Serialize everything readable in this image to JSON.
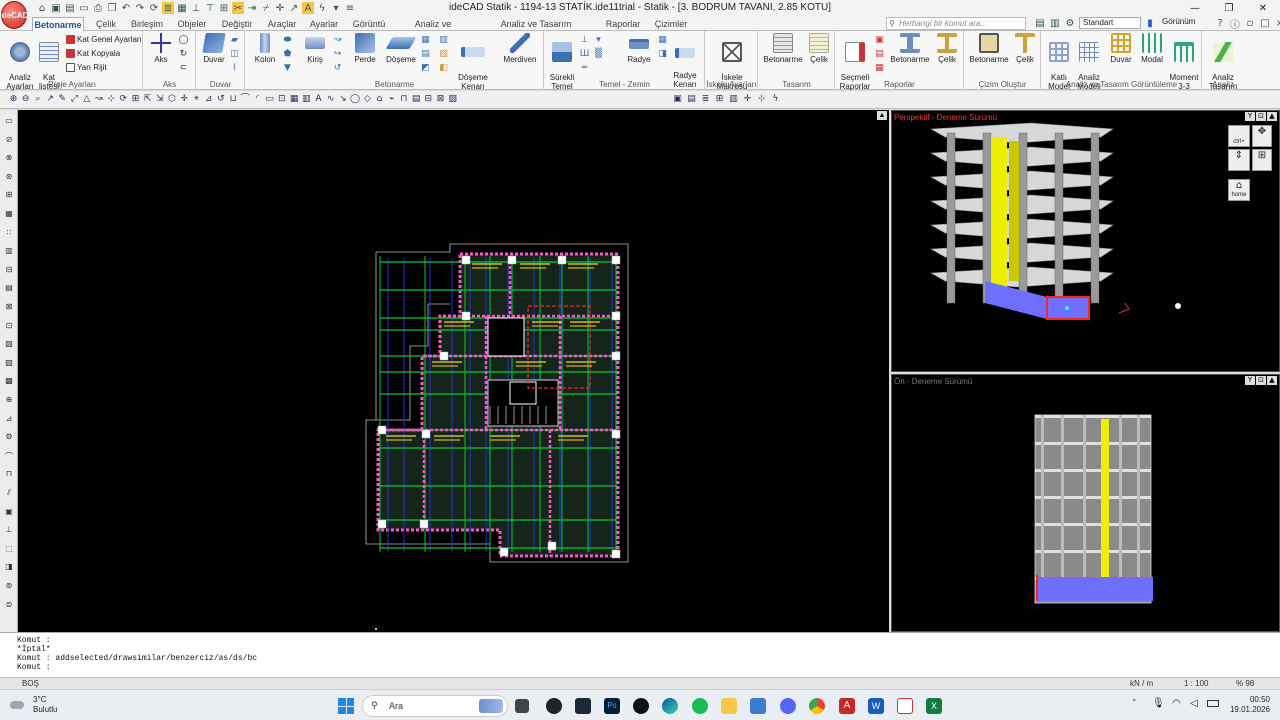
{
  "app": {
    "title": "ideCAD Statik - 1194-13 STATİK.ide11trial - Statik - [3. BODRUM TAVANI,  2.85 KOTU]",
    "logo_text": "ideCAD"
  },
  "tabs": [
    "Betonarme",
    "Çelik",
    "Birleşim",
    "Objeler",
    "Değiştir",
    "Araçlar",
    "Ayarlar",
    "Görüntü",
    "Analiz ve Tasarım",
    "Analiz ve Tasarım Görüntüleme",
    "Raporlar",
    "Çizimler"
  ],
  "search": {
    "placeholder": "Herhangi bir komut ara..."
  },
  "right_controls": {
    "style_value": "Standart",
    "view_label": "Görünüm"
  },
  "ribbon": {
    "proje": {
      "label": "Proje Ayarları",
      "analiz_ayarlari": "Analiz\nAyarları",
      "kat_listesi": "Kat\nlistesi",
      "kat_genel": "Kat Genel Ayarları",
      "kat_kopyala": "Kat Kopyala",
      "yari_rijit": "Yarı Rijit"
    },
    "aks": {
      "label": "Aks",
      "aks": "Aks"
    },
    "duvar": {
      "label": "Duvar",
      "duvar": "Duvar"
    },
    "betonarme": {
      "label": "Betonarme",
      "kolon": "Kolon",
      "kiris": "Kiriş",
      "perde": "Perde",
      "doseme": "Döşeme",
      "doseme_kenari": "Döşeme\nKenarı",
      "merdiven": "Merdiven"
    },
    "temel": {
      "label": "Temel - Zemin",
      "surekli_temel": "Sürekli\nTemel",
      "radye": "Radye",
      "radye_kenari": "Radye\nKenarı"
    },
    "iskele": {
      "label": "İskele Ayarları",
      "iskele_makrosu": "İskele\nMakrosu"
    },
    "tasarim": {
      "label": "Tasarım",
      "betonarme": "Betonarme",
      "celik": "Çelik"
    },
    "raporlar": {
      "label": "Raporlar",
      "secmeli": "Seçmeli\nRaporlar",
      "betonarme": "Betonarme",
      "celik": "Çelik"
    },
    "cizim": {
      "label": "Çizim Oluştur",
      "betonarme": "Betonarme",
      "celik": "Çelik"
    },
    "analiz_gor": {
      "label": "Analiz ve Tasarım Görüntüleme",
      "katli_model": "Katlı\nModel",
      "analiz_modeli": "Analiz\nModeli",
      "duvar": "Duvar",
      "modal": "Modal",
      "moment": "Moment\n3-3"
    },
    "analiz": {
      "label": "Analiz",
      "analiz_tasarim": "Analiz\nTasarım"
    }
  },
  "views": {
    "perspective_label": "Perspektif - Deneme Sürümü",
    "front_label": "Ön - Deneme Sürümü",
    "nav_ctrl": "ctrl+",
    "nav_home": "home"
  },
  "commands": [
    "Komut :",
    "*İptal*",
    "Komut : addselected/drawsimilar/benzerciz/as/ds/bc",
    "Komut :"
  ],
  "status": {
    "left": "BOŞ",
    "unit": "kN / m",
    "scale": "1 : 100",
    "zoom": "% 98"
  },
  "taskbar": {
    "temp": "3°C",
    "weather": "Bulutlu",
    "search": "Ara",
    "time": "00:50",
    "date": "19.01.2026"
  },
  "colors": {
    "accent": "#1a4f9a",
    "ribbon_bg": "#f7f7f7",
    "cad_bg": "#000000",
    "beam": "#00cc33",
    "axis": "#2233dd",
    "wall": "#ff55cc",
    "column_3d": "#eeee00",
    "slab_3d": "#6f6fff"
  }
}
